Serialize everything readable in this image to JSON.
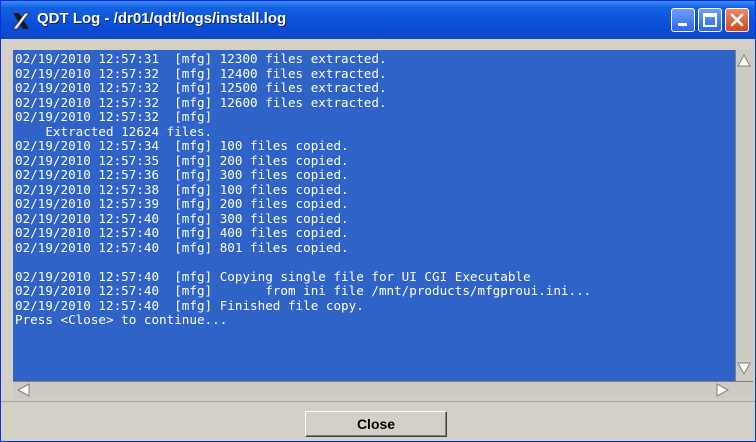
{
  "window": {
    "title": "QDT Log - /dr01/qdt/logs/install.log",
    "icon": "x-app-icon",
    "controls": [
      "minimize-icon",
      "maximize-icon",
      "close-icon"
    ]
  },
  "log": {
    "lines": [
      "02/19/2010 12:57:31  [mfg] 12300 files extracted.",
      "02/19/2010 12:57:32  [mfg] 12400 files extracted.",
      "02/19/2010 12:57:32  [mfg] 12500 files extracted.",
      "02/19/2010 12:57:32  [mfg] 12600 files extracted.",
      "02/19/2010 12:57:32  [mfg]",
      "    Extracted 12624 files.",
      "02/19/2010 12:57:34  [mfg] 100 files copied.",
      "02/19/2010 12:57:35  [mfg] 200 files copied.",
      "02/19/2010 12:57:36  [mfg] 300 files copied.",
      "02/19/2010 12:57:38  [mfg] 100 files copied.",
      "02/19/2010 12:57:39  [mfg] 200 files copied.",
      "02/19/2010 12:57:40  [mfg] 300 files copied.",
      "02/19/2010 12:57:40  [mfg] 400 files copied.",
      "02/19/2010 12:57:40  [mfg] 801 files copied.",
      "",
      "02/19/2010 12:57:40  [mfg] Copying single file for UI CGI Executable",
      "02/19/2010 12:57:40  [mfg]       from ini file /mnt/products/mfgproui.ini...",
      "02/19/2010 12:57:40  [mfg] Finished file copy.",
      "Press <Close> to continue..."
    ]
  },
  "buttons": {
    "close_label": "Close"
  },
  "colors": {
    "log_background": "#2f63c8",
    "log_text": "#ffffff",
    "titlebar": "#0a4fd8"
  }
}
